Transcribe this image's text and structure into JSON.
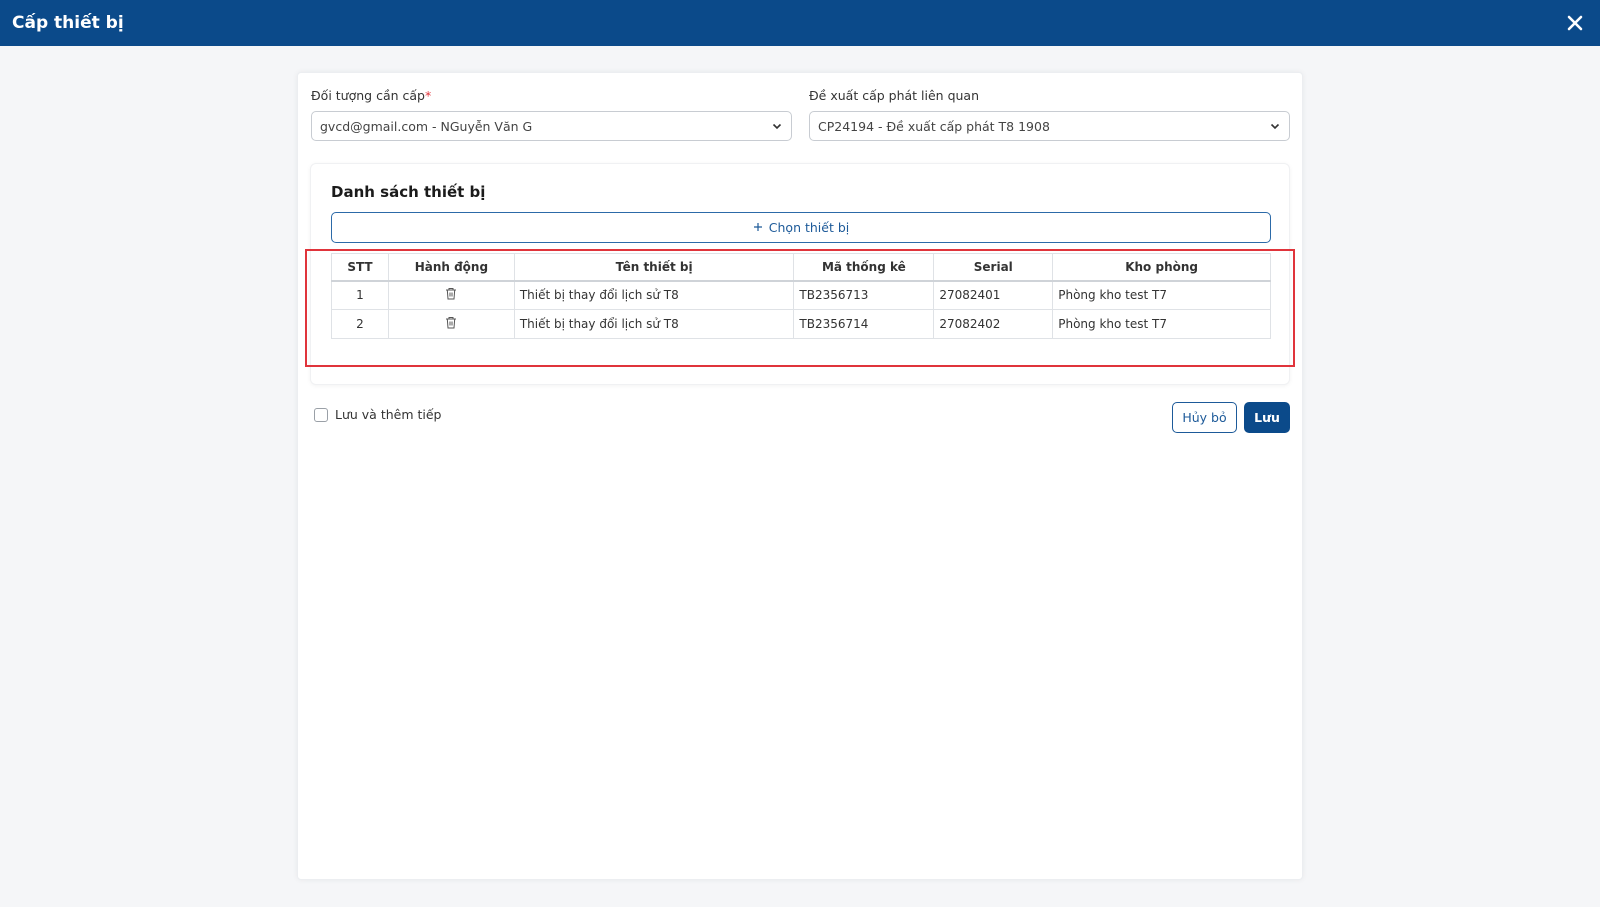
{
  "window": {
    "title": "Cấp thiết bị",
    "header_color": "#0b4a8a"
  },
  "form": {
    "target_label": "Đối tượng cần cấp",
    "target_required_mark": "*",
    "target_value": "gvcd@gmail.com - NGuyễn Văn G",
    "proposal_label": "Đề xuất cấp phát liên quan",
    "proposal_value": "CP24194 - Đề xuất cấp phát T8 1908"
  },
  "device_list": {
    "title": "Danh sách thiết bị",
    "choose_button_label": "Chọn thiết bị",
    "columns": {
      "stt": "STT",
      "action": "Hành động",
      "name": "Tên thiết bị",
      "code": "Mã thống kê",
      "serial": "Serial",
      "room": "Kho phòng"
    },
    "rows": [
      {
        "stt": "1",
        "name": "Thiết bị thay đổi lịch sử T8",
        "code": "TB2356713",
        "serial": "27082401",
        "room": "Phòng kho test T7"
      },
      {
        "stt": "2",
        "name": "Thiết bị thay đổi lịch sử T8",
        "code": "TB2356714",
        "serial": "27082402",
        "room": "Phòng kho test T7"
      }
    ]
  },
  "footer": {
    "save_and_continue_label": "Lưu và thêm tiếp",
    "cancel_label": "Hủy bỏ",
    "save_label": "Lưu"
  },
  "icons": {
    "close": "close-icon",
    "dropdown": "chevron-down-icon",
    "add": "plus-icon",
    "delete": "trash-icon"
  }
}
